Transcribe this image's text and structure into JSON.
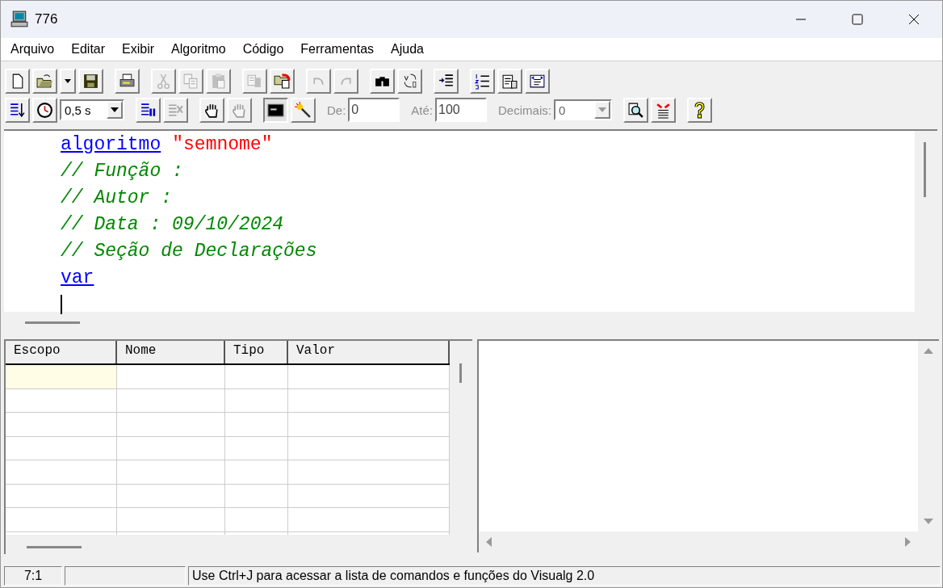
{
  "window": {
    "title": "776"
  },
  "menu": [
    "Arquivo",
    "Editar",
    "Exibir",
    "Algoritmo",
    "Código",
    "Ferramentas",
    "Ajuda"
  ],
  "toolbar_1": [
    [
      {
        "kind": "new",
        "disabled": false,
        "pressed": false
      },
      {
        "kind": "open",
        "disabled": false,
        "pressed": false
      },
      {
        "kind": "dropdown",
        "disabled": false,
        "pressed": false
      },
      {
        "kind": "save",
        "disabled": false,
        "pressed": false
      }
    ],
    [
      {
        "kind": "print",
        "disabled": false,
        "pressed": false
      }
    ],
    [
      {
        "kind": "cut",
        "disabled": true,
        "pressed": false
      },
      {
        "kind": "copy",
        "disabled": true,
        "pressed": false
      },
      {
        "kind": "paste",
        "disabled": true,
        "pressed": false
      }
    ],
    [
      {
        "kind": "doc-copy",
        "disabled": true,
        "pressed": false
      },
      {
        "kind": "folder-arrow",
        "disabled": false,
        "pressed": false
      }
    ],
    [
      {
        "kind": "undo",
        "disabled": true,
        "pressed": false
      },
      {
        "kind": "redo",
        "disabled": true,
        "pressed": false
      }
    ],
    [
      {
        "kind": "find",
        "disabled": false,
        "pressed": false
      },
      {
        "kind": "replace",
        "disabled": false,
        "pressed": false
      }
    ],
    [
      {
        "kind": "indent",
        "disabled": false,
        "pressed": false
      }
    ],
    [
      {
        "kind": "numbers",
        "disabled": false,
        "pressed": false
      },
      {
        "kind": "doc-hand",
        "disabled": false,
        "pressed": false
      },
      {
        "kind": "fit",
        "disabled": false,
        "pressed": false
      }
    ]
  ],
  "toolbar_2": {
    "left_groups": [
      [
        {
          "kind": "step",
          "disabled": false,
          "pressed": false
        },
        {
          "kind": "clock",
          "disabled": false,
          "pressed": false
        }
      ]
    ],
    "speed": {
      "value": "0,5 s"
    },
    "middle_groups": [
      [
        {
          "kind": "pause-list",
          "disabled": false,
          "pressed": false
        },
        {
          "kind": "stop",
          "disabled": true,
          "pressed": false
        }
      ],
      [
        {
          "kind": "hand",
          "disabled": false,
          "pressed": false
        },
        {
          "kind": "hand",
          "disabled": true,
          "pressed": false
        }
      ],
      [
        {
          "kind": "console",
          "disabled": false,
          "pressed": true
        },
        {
          "kind": "wand",
          "disabled": false,
          "pressed": false
        }
      ]
    ],
    "fields": [
      {
        "label": "De:",
        "value": "0",
        "disabled": true
      },
      {
        "label": "Até:",
        "value": "100",
        "disabled": true
      }
    ],
    "decimals": {
      "label": "Decimais:",
      "value": "0",
      "disabled": true
    },
    "right_groups": [
      [
        {
          "kind": "zoom-doc",
          "disabled": false,
          "pressed": false
        },
        {
          "kind": "red-arrows",
          "disabled": false,
          "pressed": false
        }
      ],
      [
        {
          "kind": "help",
          "disabled": false,
          "pressed": false
        }
      ]
    ]
  },
  "editor": {
    "lines": [
      {
        "cursor": false,
        "tokens": [
          {
            "kind": "keyword",
            "text": "algoritmo"
          },
          {
            "kind": "string",
            "text": "\"semnome\""
          }
        ]
      },
      {
        "cursor": false,
        "tokens": [
          {
            "kind": "comment",
            "text": "// Função :"
          }
        ]
      },
      {
        "cursor": false,
        "tokens": [
          {
            "kind": "comment",
            "text": "// Autor :"
          }
        ]
      },
      {
        "cursor": false,
        "tokens": [
          {
            "kind": "comment",
            "text": "// Data : 09/10/2024"
          }
        ]
      },
      {
        "cursor": false,
        "tokens": [
          {
            "kind": "comment",
            "text": "// Seção de Declarações"
          }
        ]
      },
      {
        "cursor": false,
        "tokens": [
          {
            "kind": "keyword",
            "text": "var"
          }
        ]
      },
      {
        "cursor": true
      }
    ]
  },
  "variables": {
    "columns": [
      "Escopo",
      "Nome",
      "Tipo",
      "Valor"
    ],
    "rows": [
      {
        "selected": true
      },
      {
        "selected": false
      },
      {
        "selected": false
      },
      {
        "selected": false
      },
      {
        "selected": false
      },
      {
        "selected": false
      },
      {
        "selected": false
      },
      {
        "selected": false
      }
    ]
  },
  "status_bar": {
    "position": "7:1",
    "message": "Use Ctrl+J para acessar a lista de comandos e funções do Visualg 2.0"
  }
}
